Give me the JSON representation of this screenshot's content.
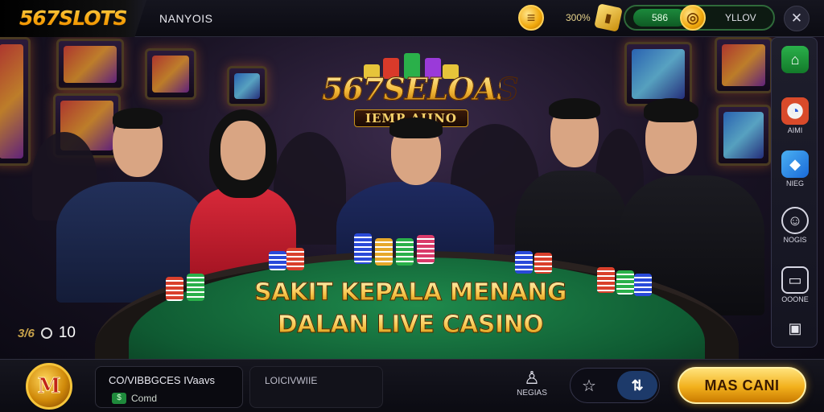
{
  "header": {
    "logo_text": "567SLOTS",
    "brand_name": "NANYOIS",
    "coin_glyph": "≡",
    "balance_percent": "300%",
    "wallet_value": "586",
    "wallet_label": "YLLOV",
    "menu_icon": "wrench-icon"
  },
  "hero": {
    "logo_title": "567SELOAS",
    "logo_sub": "IEMP AIINO",
    "headline_line1": "SAKIT KEPALA MENANG",
    "headline_line2": "DALAN LIVE CASINO",
    "pager_count": "3/6",
    "pager_number": "10"
  },
  "rail": {
    "items": [
      {
        "label": "",
        "icon": "wallet-icon"
      },
      {
        "label": "AIMI",
        "icon": "chart-icon"
      },
      {
        "label": "NIEG",
        "icon": "ticket-icon"
      },
      {
        "label": "NOGIS",
        "icon": "chat-icon"
      },
      {
        "label": "OOONE",
        "icon": "screen-icon"
      },
      {
        "label": "",
        "icon": "camera-icon"
      }
    ]
  },
  "footer": {
    "badge_letter": "M",
    "promo_title": "CO/VIBBGCES IVaavs",
    "promo_sub": "Comd",
    "login_label": "LOICIVWIIE",
    "user_label": "NEGIAS",
    "toggle_a_glyph": "☆",
    "toggle_b_glyph": "⇅",
    "cta_label": "MAS CANI"
  },
  "colors": {
    "accent_gold": "#f2b01c",
    "felt_green": "#1f8a4c",
    "wallet_green": "#1c8a3c"
  }
}
